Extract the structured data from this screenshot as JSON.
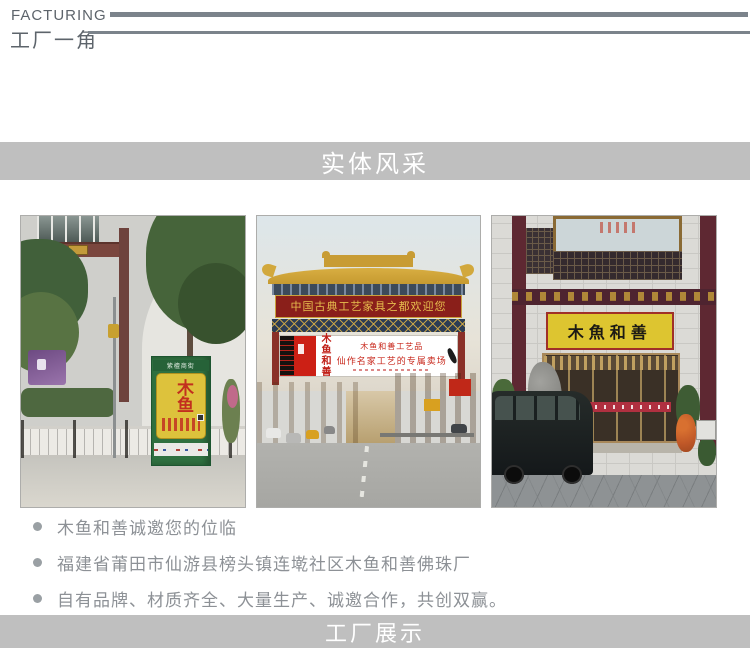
{
  "header": {
    "title_en": "FACTURING",
    "title_zh": "工厂一角"
  },
  "banners": {
    "entity": "实体风采",
    "factory": "工厂展示"
  },
  "photos": {
    "kiosk": {
      "header": "紫檀商街",
      "sign": "木鱼"
    },
    "arch": {
      "beam_text": "中国古典工艺家具之都欢迎您",
      "billboard_logo": "木鱼和善",
      "billboard_line1": "木鱼和善工艺品",
      "billboard_line2": "仙作名家工艺的专属卖场"
    },
    "storefront": {
      "sign": "木魚和善"
    }
  },
  "bullets": [
    "木鱼和善诚邀您的位临",
    "福建省莆田市仙游县榜头镇连墘社区木鱼和善佛珠厂",
    "自有品牌、材质齐全、大量生产、诚邀合作，共创双赢。"
  ],
  "colors": {
    "banner_bg": "#bfbfbf",
    "header_line": "#7b838b",
    "header_text": "#5d646b",
    "bullet_text": "#8d9196",
    "kiosk_green": "#2f7040",
    "sign_yellow": "#ddc530",
    "arch_red": "#8a1f1a",
    "roof_gold": "#d2a83c"
  }
}
